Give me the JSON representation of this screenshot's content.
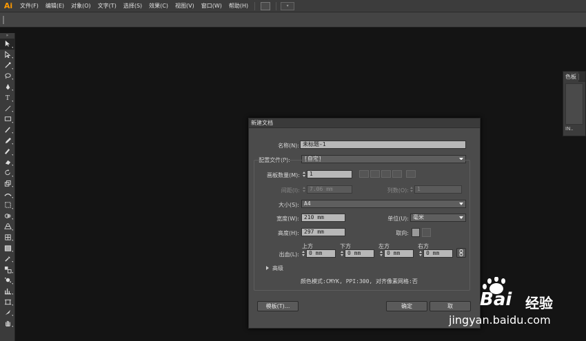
{
  "app": {
    "logo": "Ai"
  },
  "menu": [
    "文件(F)",
    "编辑(E)",
    "对象(O)",
    "文字(T)",
    "选择(S)",
    "效果(C)",
    "视图(V)",
    "窗口(W)",
    "帮助(H)"
  ],
  "tool_icons": [
    "selection-tool-icon",
    "direct-selection-tool-icon",
    "magic-wand-tool-icon",
    "lasso-tool-icon",
    "pen-tool-icon",
    "type-tool-icon",
    "line-tool-icon",
    "rectangle-tool-icon",
    "paintbrush-tool-icon",
    "pencil-tool-icon",
    "blob-brush-tool-icon",
    "eraser-tool-icon",
    "rotate-tool-icon",
    "scale-tool-icon",
    "width-tool-icon",
    "free-transform-tool-icon",
    "shape-builder-tool-icon",
    "perspective-grid-tool-icon",
    "mesh-tool-icon",
    "gradient-tool-icon",
    "eyedropper-tool-icon",
    "blend-tool-icon",
    "symbol-sprayer-tool-icon",
    "column-graph-tool-icon",
    "artboard-tool-icon",
    "slice-tool-icon",
    "hand-tool-icon"
  ],
  "panel": {
    "tab_label": "色板",
    "footer": "IN.."
  },
  "dialog": {
    "title": "新建文档",
    "name_label": "名称(N):",
    "name_value": "未标题-1",
    "profile_label": "配置文件(P):",
    "profile_value": "[自定]",
    "artboards_label": "画板数量(M):",
    "artboards_value": "1",
    "spacing_label": "间距(I):",
    "spacing_value": "7.06 mm",
    "columns_label": "列数(O):",
    "columns_value": "1",
    "size_label": "大小(S):",
    "size_value": "A4",
    "width_label": "宽度(W):",
    "width_value": "210 mm",
    "units_label": "单位(U):",
    "units_value": "毫米",
    "height_label": "高度(H):",
    "height_value": "297 mm",
    "orientation_label": "取向:",
    "bleed_label": "出血(L):",
    "bleed_top_label": "上方",
    "bleed_bottom_label": "下方",
    "bleed_left_label": "左方",
    "bleed_right_label": "右方",
    "bleed_top": "0 mm",
    "bleed_bottom": "0 mm",
    "bleed_left": "0 mm",
    "bleed_right": "0 mm",
    "advanced_label": "高级",
    "summary": "颜色模式:CMYK, PPI:300, 对齐像素网格:否",
    "templates_button": "模板(T)...",
    "ok_button": "确定",
    "cancel_button": "取"
  },
  "watermark": {
    "brand": "Bai",
    "brand_cn": "经验",
    "url": "jingyan.baidu.com"
  },
  "colors": {
    "logo": "#ff9a00",
    "ui_bg": "#141414",
    "dialog_bg": "#4b4b4b"
  }
}
